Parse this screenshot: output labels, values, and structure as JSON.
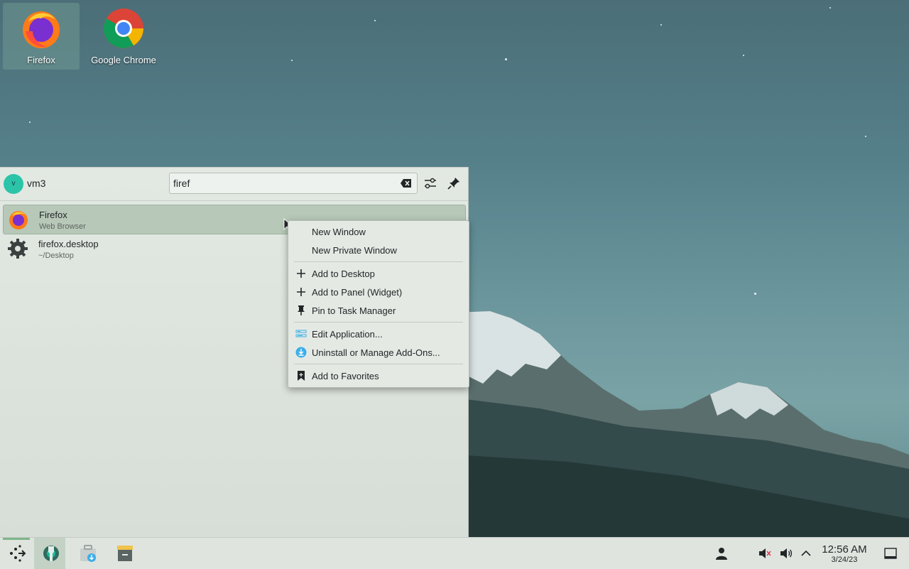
{
  "desktop": {
    "icons": [
      {
        "label": "Firefox",
        "icon": "firefox-icon",
        "selected": true
      },
      {
        "label": "Google Chrome",
        "icon": "chrome-icon",
        "selected": false
      }
    ]
  },
  "launcher": {
    "user": {
      "initial": "v",
      "name": "vm3"
    },
    "search": {
      "value": "firef"
    },
    "results": [
      {
        "name": "Firefox",
        "subtitle": "Web Browser",
        "icon": "firefox-icon"
      },
      {
        "name": "firefox.desktop",
        "subtitle": "~/Desktop",
        "icon": "gear-icon"
      }
    ]
  },
  "context_menu": {
    "items": [
      {
        "label": "New Window",
        "icon": ""
      },
      {
        "label": "New Private Window",
        "icon": ""
      },
      {
        "label": "Add to Desktop",
        "icon": "plus-icon"
      },
      {
        "label": "Add to Panel (Widget)",
        "icon": "plus-icon"
      },
      {
        "label": "Pin to Task Manager",
        "icon": "pin-icon"
      },
      {
        "label": "Edit Application...",
        "icon": "edit-app-icon"
      },
      {
        "label": "Uninstall or Manage Add-Ons...",
        "icon": "download-icon"
      },
      {
        "label": "Add to Favorites",
        "icon": "bookmark-icon"
      }
    ]
  },
  "taskbar": {
    "apps": [
      "application-launcher-icon",
      "system-settings-icon",
      "discover-store-icon",
      "file-archiver-icon"
    ],
    "tray": [
      "user-icon",
      "mic-muted-icon",
      "volume-icon",
      "expand-tray-icon",
      "show-desktop-icon"
    ],
    "clock": {
      "time": "12:56 AM",
      "date": "3/24/23"
    }
  },
  "colors": {
    "accent": "#2bc4a8",
    "panel_bg": "#dfe4df",
    "menu_bg": "#e4e9e4"
  }
}
